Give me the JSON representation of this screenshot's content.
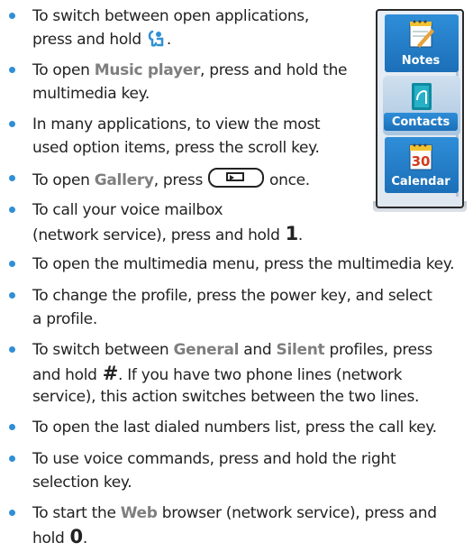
{
  "bullets": [
    {
      "parts": [
        "To switch between open applications,",
        "press and hold"
      ]
    },
    {
      "parts": [
        "To open ",
        "Music player",
        ", press and hold the",
        "multimedia key."
      ]
    },
    {
      "parts": [
        "In many applications, to view the most",
        "used option items, press the scroll key."
      ]
    },
    {
      "parts": [
        "To open ",
        "Gallery",
        ", press",
        "once."
      ]
    },
    {
      "parts": [
        "To call your voice mailbox",
        "(network service), press and hold",
        "1",
        "."
      ]
    },
    {
      "parts": [
        "To open the multimedia menu, press the multimedia key."
      ]
    },
    {
      "parts": [
        "To change the profile, press the power key, and select",
        "a profile."
      ]
    },
    {
      "parts": [
        "To switch between ",
        "General",
        " and ",
        "Silent",
        " profiles, press",
        "and hold",
        "#",
        ". If you have two phone lines (network",
        "service), this action switches between the two lines."
      ]
    },
    {
      "parts": [
        "To open the last dialed numbers list, press the call key."
      ]
    },
    {
      "parts": [
        "To use voice commands, press and hold the right",
        "selection key."
      ]
    },
    {
      "parts": [
        "To start the ",
        "Web",
        " browser (network service), press and",
        "hold",
        "0",
        "."
      ]
    }
  ],
  "phone_menu": {
    "items": [
      "Notes",
      "Contacts",
      "Calendar"
    ],
    "calendar_day": "30"
  },
  "icons": {
    "app_key": "applications-key-icon",
    "gallery_key": "gallery-key-icon"
  },
  "colors": {
    "bullet": "#2f8fd6",
    "highlight": "#7f7f7f",
    "menu_band": "#1b6fb8"
  }
}
